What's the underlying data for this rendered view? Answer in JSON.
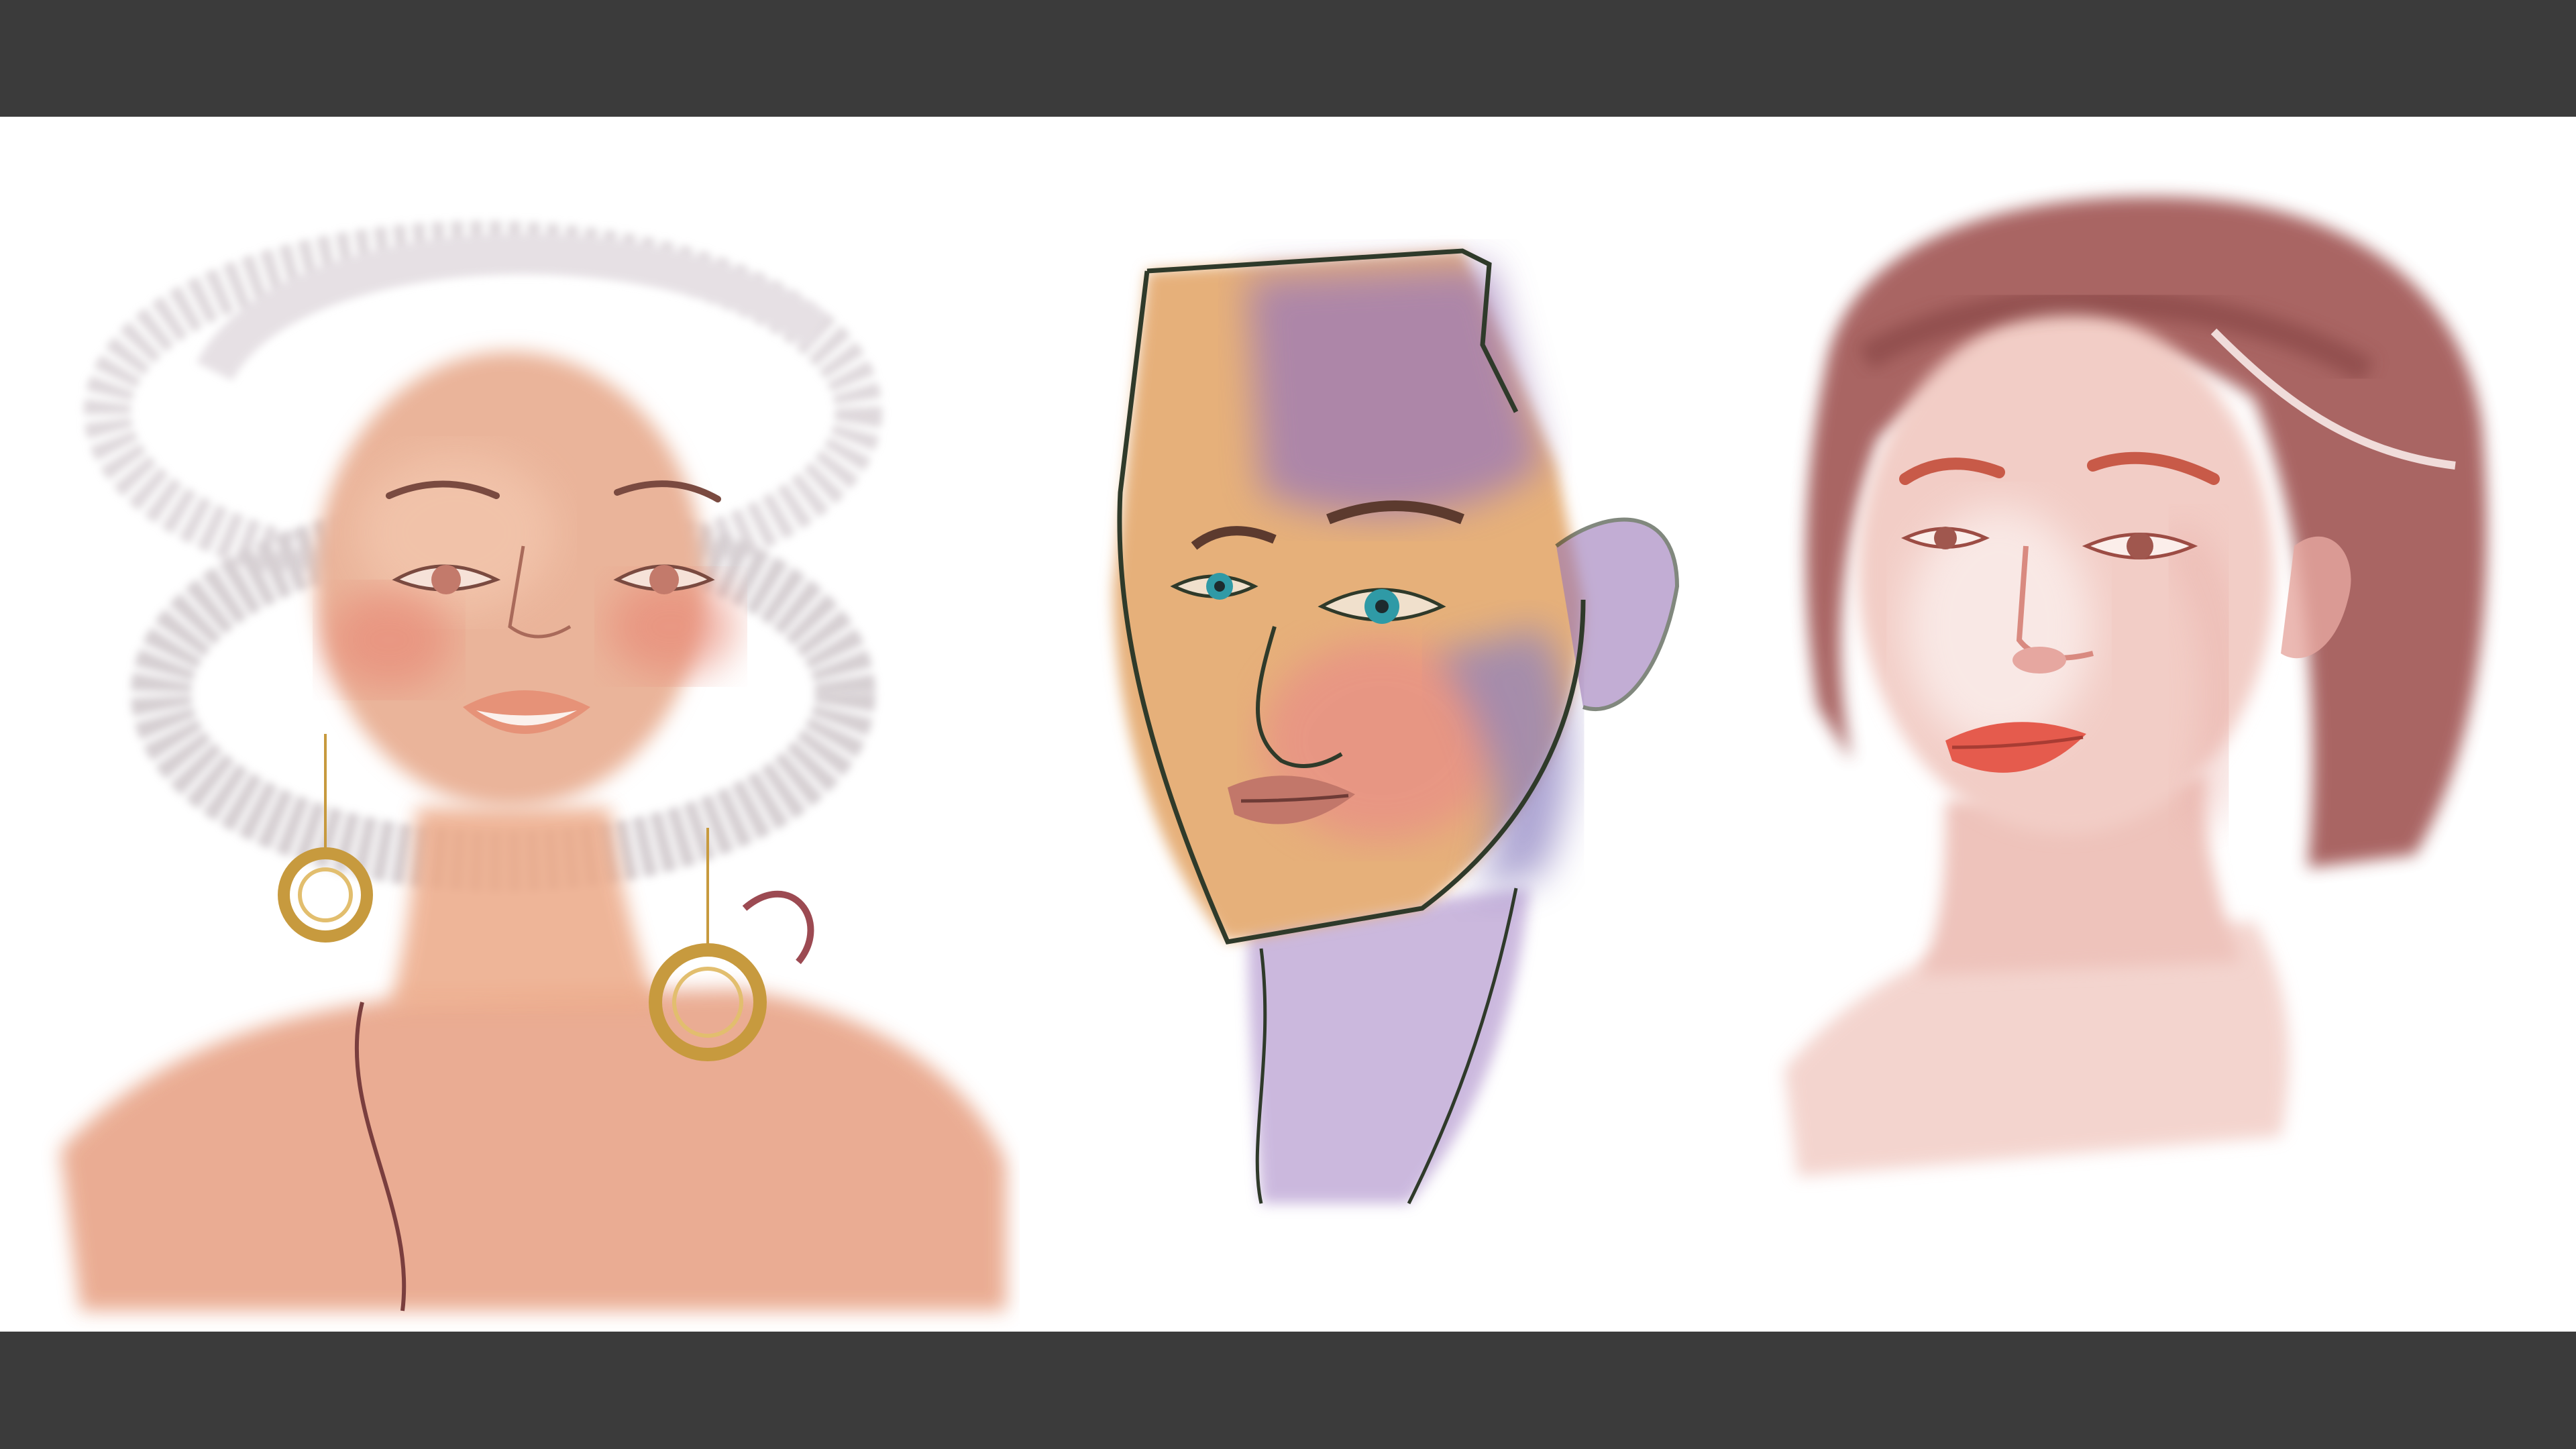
{
  "scene": {
    "frame_color": "#3b3b3b",
    "canvas_color": "#ffffff",
    "portraits": [
      {
        "subject": "woman-looking-up-with-hoop-earrings",
        "palette": {
          "skin": "#e8a488",
          "skin_light": "#f3c6ad",
          "cheek": "#e88b78",
          "lips": "#e69278",
          "lines": "#7a4a40",
          "hat": "#cfc7cb",
          "earring": "#c79a3e"
        }
      },
      {
        "subject": "three-quarter-face-pastel-sketch",
        "palette": {
          "skin": "#e6b07a",
          "shadow": "#9a78b8",
          "hair_shadow": "#8a7fc0",
          "lines": "#2f3a2a",
          "lips": "#c2776a",
          "iris": "#2f9aa6",
          "blush": "#e9868a"
        }
      },
      {
        "subject": "woman-with-short-bob-watercolor",
        "palette": {
          "skin": "#f2cdc6",
          "skin_mid": "#e6a7a0",
          "hair": "#a05552",
          "hair_dark": "#7c3b3a",
          "lips": "#e55b4d",
          "brows": "#c85a48"
        }
      }
    ]
  }
}
